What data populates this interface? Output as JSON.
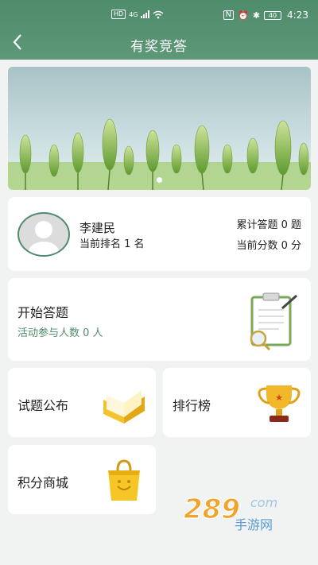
{
  "status_bar": {
    "time": "4:23",
    "battery": "40",
    "left_badge": "HD",
    "network": "4G"
  },
  "header": {
    "title": "有奖竞答"
  },
  "profile": {
    "name": "李建民",
    "rank_text": "当前排名 1 名",
    "total_answers_text": "累计答题 0 题",
    "current_score_text": "当前分数 0 分"
  },
  "start_card": {
    "title": "开始答题",
    "participants_text": "活动参与人数 0 人"
  },
  "tiles": [
    {
      "label": "试题公布",
      "icon": "open-book-icon"
    },
    {
      "label": "排行榜",
      "icon": "trophy-icon"
    },
    {
      "label": "积分商城",
      "icon": "shopping-bag-icon"
    }
  ],
  "watermark": {
    "brand": "289",
    "sub": "手游网",
    "suffix": "com"
  },
  "colors": {
    "accent": "#4f8c6c",
    "background": "#f1f3f2"
  }
}
